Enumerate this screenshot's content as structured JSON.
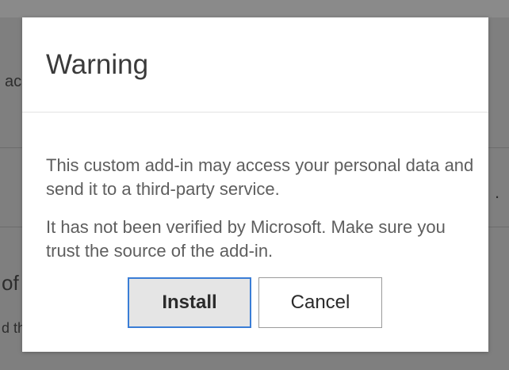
{
  "background": {
    "fragment_1": "ac",
    "fragment_2": "of",
    "fragment_3": "d th",
    "fragment_4": "."
  },
  "dialog": {
    "title": "Warning",
    "body_paragraph_1": "This custom add-in may access your personal data and send it to a third-party service.",
    "body_paragraph_2": "It has not been verified by Microsoft. Make sure you trust the source of the add-in.",
    "install_label": "Install",
    "cancel_label": "Cancel"
  },
  "colors": {
    "primary_border": "#3a7dd6",
    "overlay": "#7f7f7f",
    "dialog_bg": "#ffffff"
  }
}
